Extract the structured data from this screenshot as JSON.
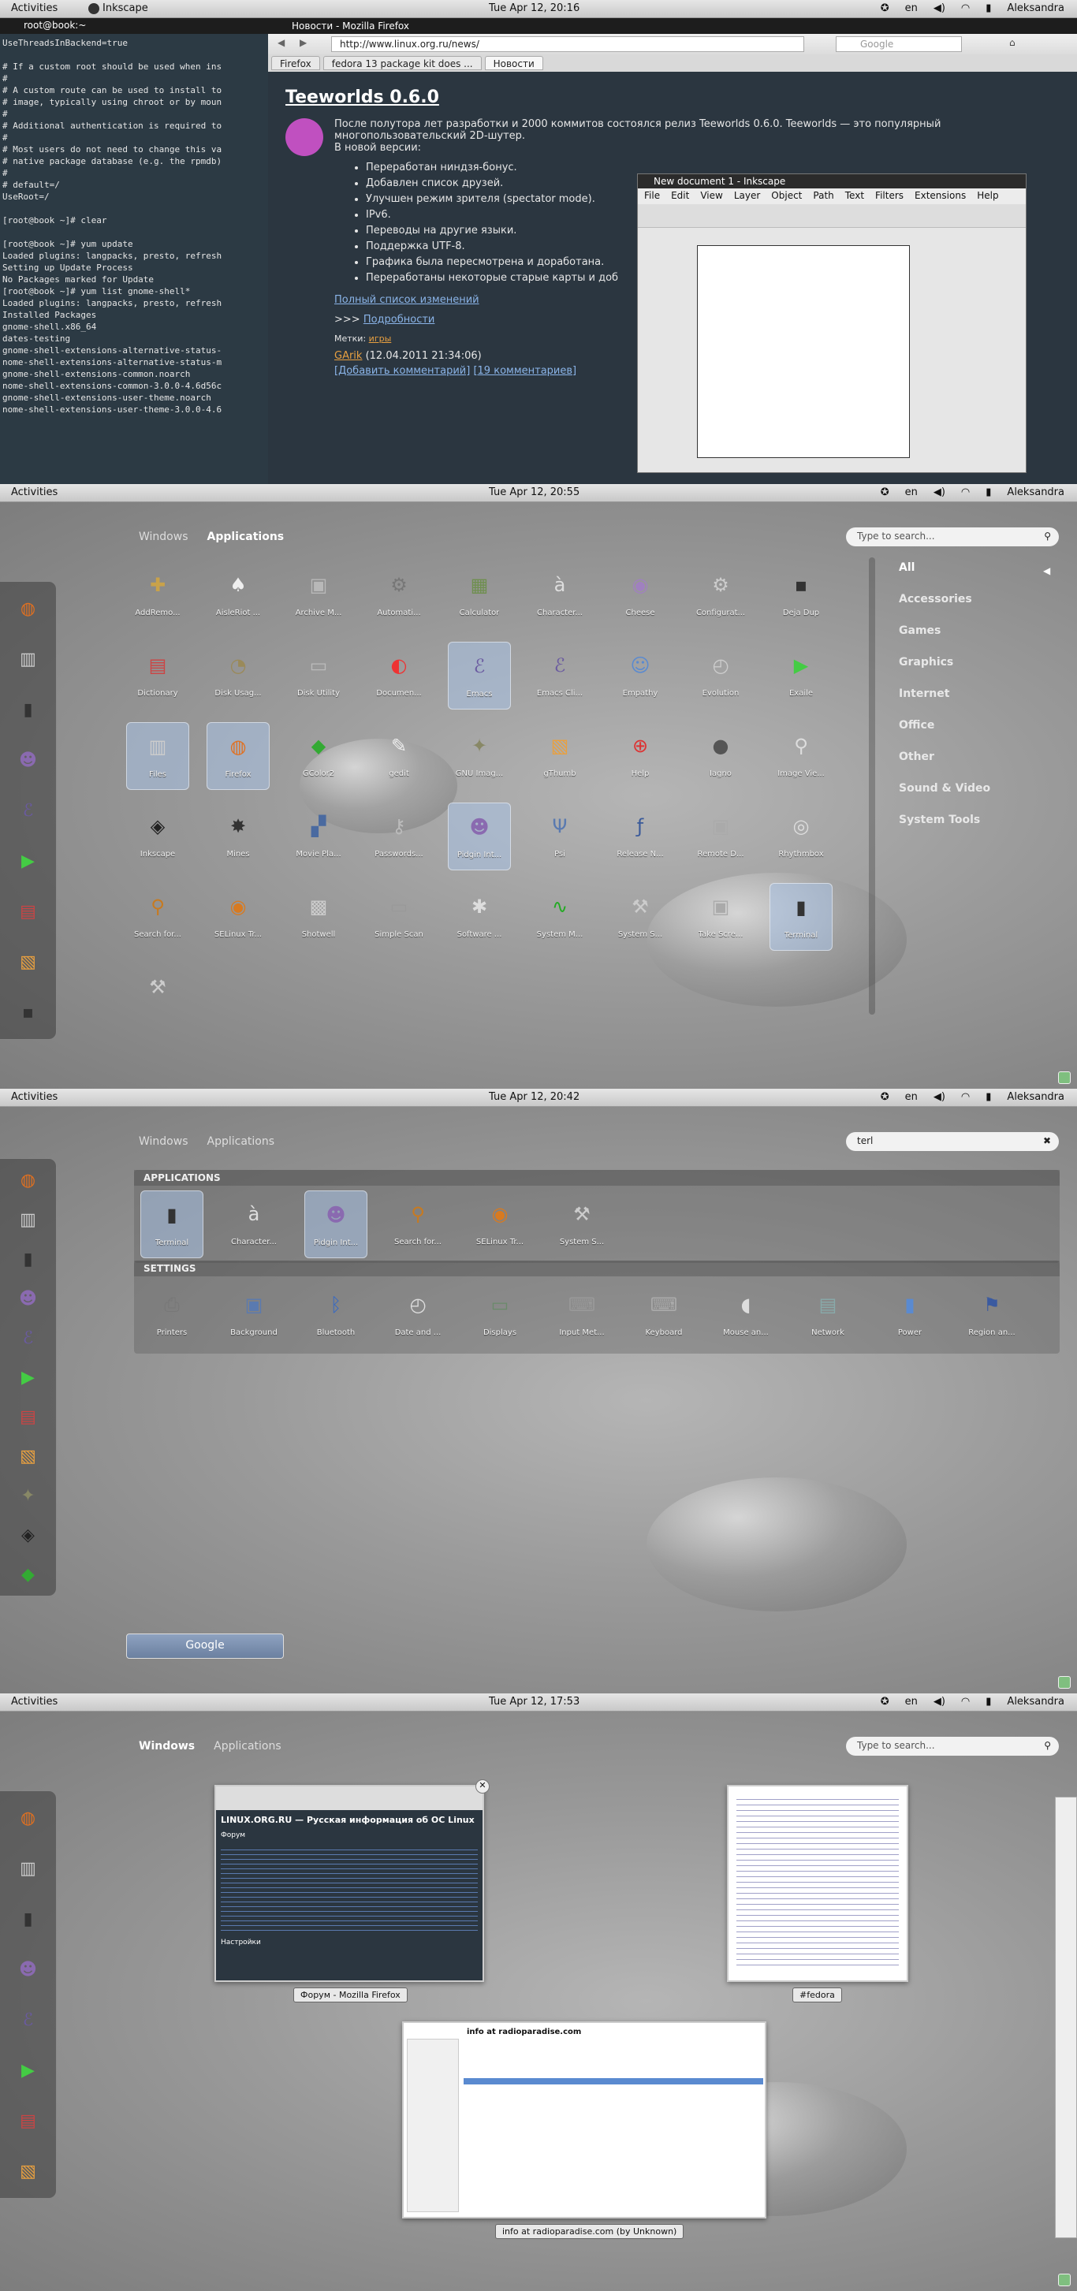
{
  "topbar": {
    "activities": "Activities",
    "user": "Aleksandra",
    "lang": "en",
    "s1_clock": "Tue Apr 12, 20:16",
    "s1_app": "Inkscape",
    "s2_clock": "Tue Apr 12, 20:55",
    "s3_clock": "Tue Apr 12, 20:42",
    "s4_clock": "Tue Apr 12, 17:53"
  },
  "overview": {
    "tab_windows": "Windows",
    "tab_applications": "Applications",
    "search_placeholder": "Type to search...",
    "search_query": "terl"
  },
  "desktop": {
    "terminal_title": "root@book:~",
    "terminal_text": "UseThreadsInBackend=true\n\n# If a custom root should be used when ins\n#\n# A custom route can be used to install to\n# image, typically using chroot or by moun\n#\n# Additional authentication is required to\n#\n# Most users do not need to change this va\n# native package database (e.g. the rpmdb)\n#\n# default=/\nUseRoot=/\n\n[root@book ~]# clear\n\n[root@book ~]# yum update\nLoaded plugins: langpacks, presto, refresh\nSetting up Update Process\nNo Packages marked for Update\n[root@book ~]# yum list gnome-shell*\nLoaded plugins: langpacks, presto, refresh\nInstalled Packages\ngnome-shell.x86_64\ndates-testing\ngnome-shell-extensions-alternative-status-\nnome-shell-extensions-alternative-status-m\ngnome-shell-extensions-common.noarch\nnome-shell-extensions-common-3.0.0-4.6d56c\ngnome-shell-extensions-user-theme.noarch\nnome-shell-extensions-user-theme-3.0.0-4.6",
    "firefox_title": "Новости - Mozilla Firefox",
    "url": "http://www.linux.org.ru/news/",
    "google_placeholder": "Google",
    "firefox_menu": "Firefox",
    "tab1": "fedora 13 package kit does ...",
    "tab2": "Новости",
    "article_title": "Teeworlds 0.6.0",
    "article_intro": "После полутора лет разработки и 2000 коммитов состоялся релиз Teeworlds 0.6.0. Teeworlds — это популярный многопользовательский 2D-шутер.",
    "article_new": "В новой версии:",
    "bullets": [
      "Переработан ниндзя-бонус.",
      "Добавлен список друзей.",
      "Улучшен режим зрителя (spectator mode).",
      "IPv6.",
      "Переводы на другие языки.",
      "Поддержка UTF-8.",
      "Графика была пересмотрена и доработана.",
      "Переработаны некоторые старые карты и доб"
    ],
    "full_changes": "Полный список изменений",
    "more_prefix": ">>> ",
    "more": "Подробности",
    "tags_label": "Метки: ",
    "tags": "игры",
    "author": "GArik",
    "date": "(12.04.2011 21:34:06)",
    "add_comment": "[Добавить комментарий]",
    "comments": "[19 комментариев]",
    "inkscape_title": "New document 1 - Inkscape",
    "inkscape_menu": [
      "File",
      "Edit",
      "View",
      "Layer",
      "Object",
      "Path",
      "Text",
      "Filters",
      "Extensions",
      "Help"
    ]
  },
  "apps": [
    {
      "label": "AddRemo...",
      "icon": "✚",
      "color": "#c9a24a"
    },
    {
      "label": "AisleRiot ...",
      "icon": "♠",
      "color": "#eee"
    },
    {
      "label": "Archive M...",
      "icon": "▣",
      "color": "#b8b8b8"
    },
    {
      "label": "Automati...",
      "icon": "⚙",
      "color": "#777"
    },
    {
      "label": "Calculator",
      "icon": "▦",
      "color": "#6f8f4f"
    },
    {
      "label": "Character...",
      "icon": "à",
      "color": "#ddd"
    },
    {
      "label": "Cheese",
      "icon": "◉",
      "color": "#a080c0"
    },
    {
      "label": "Configurat...",
      "icon": "⚙",
      "color": "#ccc"
    },
    {
      "label": "Deja Dup",
      "icon": "▪",
      "color": "#333"
    },
    {
      "label": "Dictionary",
      "icon": "▤",
      "color": "#c44"
    },
    {
      "label": "Disk Usag...",
      "icon": "◔",
      "color": "#9a8a5a"
    },
    {
      "label": "Disk Utility",
      "icon": "▭",
      "color": "#bbb"
    },
    {
      "label": "Documen...",
      "icon": "◐",
      "color": "#e33"
    },
    {
      "label": "Emacs",
      "icon": "ℰ",
      "color": "#6a5aa0"
    },
    {
      "label": "Emacs Cli...",
      "icon": "ℰ",
      "color": "#6a5aa0"
    },
    {
      "label": "Empathy",
      "icon": "☺",
      "color": "#5a8ad0"
    },
    {
      "label": "Evolution",
      "icon": "◴",
      "color": "#ccc"
    },
    {
      "label": "Exaile",
      "icon": "▶",
      "color": "#4c4"
    },
    {
      "label": "Files",
      "icon": "▥",
      "color": "#ccc"
    },
    {
      "label": "Firefox",
      "icon": "◍",
      "color": "#e07020"
    },
    {
      "label": "GColor2",
      "icon": "◆",
      "color": "#3a3"
    },
    {
      "label": "gedit",
      "icon": "✎",
      "color": "#eee"
    },
    {
      "label": "GNU Imag...",
      "icon": "✦",
      "color": "#886"
    },
    {
      "label": "gThumb",
      "icon": "▧",
      "color": "#e8a040"
    },
    {
      "label": "Help",
      "icon": "⊕",
      "color": "#d33"
    },
    {
      "label": "Iagno",
      "icon": "●",
      "color": "#555"
    },
    {
      "label": "Image Vie...",
      "icon": "⚲",
      "color": "#ddd"
    },
    {
      "label": "Inkscape",
      "icon": "◈",
      "color": "#222"
    },
    {
      "label": "Mines",
      "icon": "✸",
      "color": "#333"
    },
    {
      "label": "Movie Pla...",
      "icon": "▞",
      "color": "#4a6aa0"
    },
    {
      "label": "Passwords...",
      "icon": "⚷",
      "color": "#bbb"
    },
    {
      "label": "Pidgin Int...",
      "icon": "☻",
      "color": "#8a6ab0"
    },
    {
      "label": "Psi",
      "icon": "Ψ",
      "color": "#5a7ab0"
    },
    {
      "label": "Release N...",
      "icon": "ƒ",
      "color": "#3a5a9a"
    },
    {
      "label": "Remote D...",
      "icon": "▣",
      "color": "#aaa"
    },
    {
      "label": "Rhythmbox",
      "icon": "◎",
      "color": "#ddd"
    },
    {
      "label": "Search for...",
      "icon": "⚲",
      "color": "#c77a20"
    },
    {
      "label": "SELinux Tr...",
      "icon": "◉",
      "color": "#d87a20"
    },
    {
      "label": "Shotwell",
      "icon": "▩",
      "color": "#ccc"
    },
    {
      "label": "Simple Scan",
      "icon": "▭",
      "color": "#999"
    },
    {
      "label": "Software ...",
      "icon": "✱",
      "color": "#ddd"
    },
    {
      "label": "System M...",
      "icon": "∿",
      "color": "#2a2"
    },
    {
      "label": "System S...",
      "icon": "⚒",
      "color": "#ccc"
    },
    {
      "label": "Take Scre...",
      "icon": "▣",
      "color": "#aaa"
    },
    {
      "label": "Terminal",
      "icon": "▮",
      "color": "#333"
    },
    {
      "label": "",
      "icon": "⚒",
      "color": "#ccc"
    }
  ],
  "categories": [
    "All",
    "Accessories",
    "Games",
    "Graphics",
    "Internet",
    "Office",
    "Other",
    "Sound & Video",
    "System Tools"
  ],
  "results": {
    "applications_header": "APPLICATIONS",
    "settings_header": "SETTINGS",
    "applications": [
      {
        "label": "Terminal",
        "icon": "▮",
        "color": "#333"
      },
      {
        "label": "Character...",
        "icon": "à",
        "color": "#ddd"
      },
      {
        "label": "Pidgin Int...",
        "icon": "☻",
        "color": "#8a6ab0"
      },
      {
        "label": "Search for...",
        "icon": "⚲",
        "color": "#c77a20"
      },
      {
        "label": "SELinux Tr...",
        "icon": "◉",
        "color": "#d87a20"
      },
      {
        "label": "System S...",
        "icon": "⚒",
        "color": "#ccc"
      }
    ],
    "settings": [
      {
        "label": "Printers",
        "icon": "⎙",
        "color": "#777"
      },
      {
        "label": "Background",
        "icon": "▣",
        "color": "#5a7ab0"
      },
      {
        "label": "Bluetooth",
        "icon": "ᛒ",
        "color": "#3a6ac0"
      },
      {
        "label": "Date and ...",
        "icon": "◴",
        "color": "#ddd"
      },
      {
        "label": "Displays",
        "icon": "▭",
        "color": "#6a8a6a"
      },
      {
        "label": "Input Met...",
        "icon": "⌨",
        "color": "#999"
      },
      {
        "label": "Keyboard",
        "icon": "⌨",
        "color": "#aaa"
      },
      {
        "label": "Mouse an...",
        "icon": "◖",
        "color": "#ddd"
      },
      {
        "label": "Network",
        "icon": "▤",
        "color": "#8aa"
      },
      {
        "label": "Power",
        "icon": "▮",
        "color": "#5a8ad0"
      },
      {
        "label": "Region an...",
        "icon": "⚑",
        "color": "#3a5aa0"
      }
    ],
    "google_button": "Google"
  },
  "windows": {
    "firefox_label": "Форум - Mozilla Firefox",
    "fedora_label": "#fedora",
    "radio_label": "info at radioparadise.com (by Unknown)",
    "firefox_heading": "LINUX.ORG.RU — Русская информация об ОС Linux",
    "firefox_section": "Форум",
    "firefox_section2": "Настройки",
    "radio_heading": "info at radioparadise.com"
  }
}
